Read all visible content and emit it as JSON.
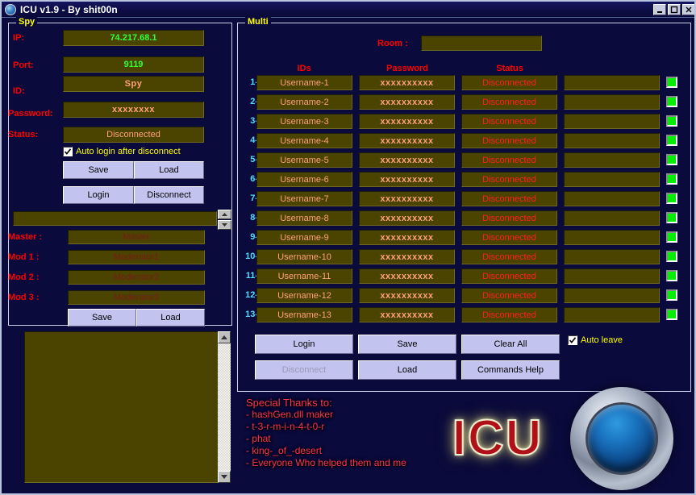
{
  "window": {
    "title": "ICU v1.9 - By shit00n",
    "icon": "app-orb-icon",
    "minimize": "–",
    "maximize": "□",
    "close": "✕"
  },
  "spy": {
    "caption": "Spy",
    "labels": {
      "ip": "IP:",
      "port": "Port:",
      "id": "ID:",
      "password": "Password:",
      "status": "Status:"
    },
    "values": {
      "ip": "74.217.68.1",
      "port": "9119",
      "id": "Spy",
      "password": "xxxxxxxx",
      "status": "Disconnected"
    },
    "auto_login": {
      "label": "Auto login after disconnect",
      "checked": true
    },
    "buttons": {
      "save": "Save",
      "load": "Load",
      "login": "Login",
      "disconnect": "Disconnect"
    }
  },
  "staff": {
    "command_value": "",
    "labels": {
      "master": "Master :",
      "mod1": "Mod 1 :",
      "mod2": "Mod 2 :",
      "mod3": "Mod 3 :"
    },
    "values": {
      "master": "Master",
      "mod1": "Moderator1",
      "mod2": "Moderator2",
      "mod3": "Moderator3"
    },
    "buttons": {
      "save": "Save",
      "load": "Load"
    }
  },
  "log": {
    "text": ""
  },
  "multi": {
    "caption": "Multi",
    "room_label": "Room :",
    "room_value": "",
    "columns": {
      "ids": "IDs",
      "password": "Password",
      "status": "Status"
    },
    "rows": [
      {
        "num": "1-",
        "id": "Username-1",
        "password": "xxxxxxxxxx",
        "status": "Disconnected",
        "extra": "",
        "led": "green"
      },
      {
        "num": "2-",
        "id": "Username-2",
        "password": "xxxxxxxxxx",
        "status": "Disconnected",
        "extra": "",
        "led": "green"
      },
      {
        "num": "3-",
        "id": "Username-3",
        "password": "xxxxxxxxxx",
        "status": "Disconnected",
        "extra": "",
        "led": "green"
      },
      {
        "num": "4-",
        "id": "Username-4",
        "password": "xxxxxxxxxx",
        "status": "Disconnected",
        "extra": "",
        "led": "green"
      },
      {
        "num": "5-",
        "id": "Username-5",
        "password": "xxxxxxxxxx",
        "status": "Disconnected",
        "extra": "",
        "led": "green"
      },
      {
        "num": "6-",
        "id": "Username-6",
        "password": "xxxxxxxxxx",
        "status": "Disconnected",
        "extra": "",
        "led": "green"
      },
      {
        "num": "7-",
        "id": "Username-7",
        "password": "xxxxxxxxxx",
        "status": "Disconnected",
        "extra": "",
        "led": "green"
      },
      {
        "num": "8-",
        "id": "Username-8",
        "password": "xxxxxxxxxx",
        "status": "Disconnected",
        "extra": "",
        "led": "green"
      },
      {
        "num": "9-",
        "id": "Username-9",
        "password": "xxxxxxxxxx",
        "status": "Disconnected",
        "extra": "",
        "led": "green"
      },
      {
        "num": "10-",
        "id": "Username-10",
        "password": "xxxxxxxxxx",
        "status": "Disconnected",
        "extra": "",
        "led": "green"
      },
      {
        "num": "11-",
        "id": "Username-11",
        "password": "xxxxxxxxxx",
        "status": "Disconnected",
        "extra": "",
        "led": "green"
      },
      {
        "num": "12-",
        "id": "Username-12",
        "password": "xxxxxxxxxx",
        "status": "Disconnected",
        "extra": "",
        "led": "green"
      },
      {
        "num": "13-",
        "id": "Username-13",
        "password": "xxxxxxxxxx",
        "status": "Disconnected",
        "extra": "",
        "led": "green"
      }
    ],
    "buttons": {
      "login": "Login",
      "save": "Save",
      "clear_all": "Clear All",
      "disconnect": "Disconnect",
      "load": "Load",
      "commands_help": "Commands Help"
    },
    "disconnect_enabled": false,
    "auto_leave": {
      "label": "Auto leave",
      "checked": true
    }
  },
  "thanks": {
    "heading": "Special Thanks to:",
    "lines": [
      "- hashGen.dll maker",
      "- t-3-r-m-i-n-4-t-0-r",
      "- phat",
      "- king-_of_-desert",
      "- Everyone Who helped them and me"
    ]
  },
  "logo": {
    "text": "ICU"
  },
  "colors": {
    "background": "#0a0a3c",
    "field": "#4a4400",
    "label": "#ff0000",
    "caption": "#ffff00",
    "value_green": "#33ff33",
    "value_salmon": "#ffa07a",
    "row_number": "#55ddff",
    "led_on": "#00ee00",
    "button_face": "#c3c3f0"
  }
}
